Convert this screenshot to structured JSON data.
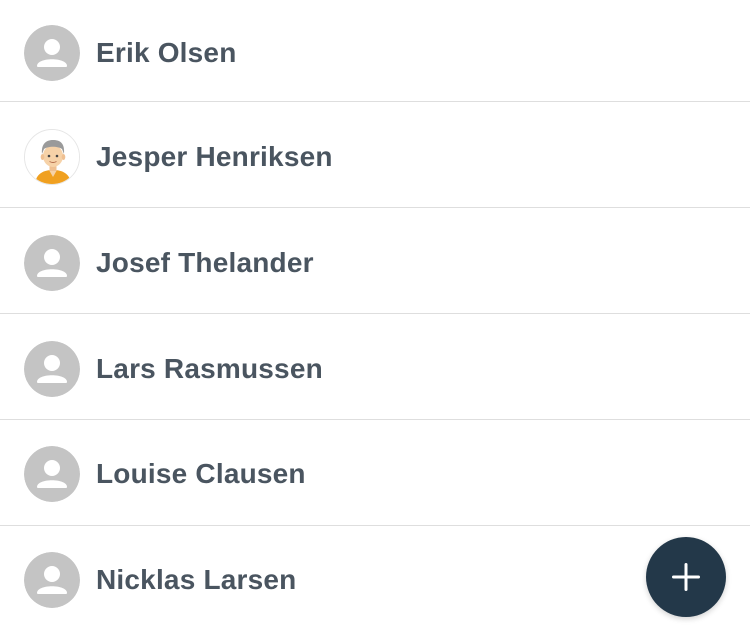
{
  "contacts": [
    {
      "name": "Erik Olsen",
      "avatar": "default-person-icon"
    },
    {
      "name": "Jesper Henriksen",
      "avatar": "cartoon-portrait"
    },
    {
      "name": "Josef Thelander",
      "avatar": "default-person-icon"
    },
    {
      "name": "Lars Rasmussen",
      "avatar": "default-person-icon"
    },
    {
      "name": "Louise Clausen",
      "avatar": "default-person-icon"
    },
    {
      "name": "Nicklas Larsen",
      "avatar": "default-person-icon"
    }
  ],
  "fab": {
    "icon": "plus-icon"
  },
  "colors": {
    "name_text": "#4a5560",
    "avatar_bg": "#c4c4c4",
    "divider": "#dedede",
    "fab_bg": "#233849"
  }
}
